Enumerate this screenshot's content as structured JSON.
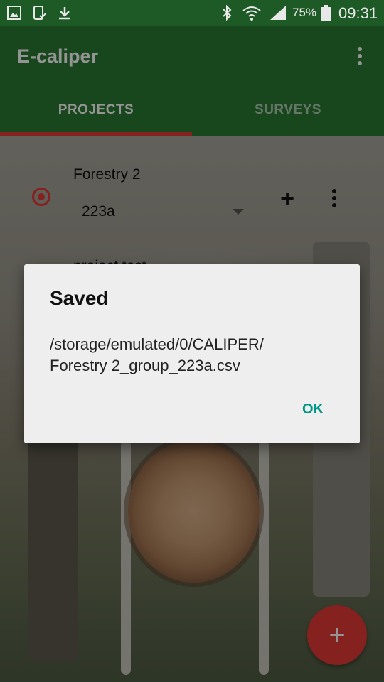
{
  "status_bar": {
    "battery_percent": "75%",
    "time": "09:31",
    "icons": [
      "image-icon",
      "phone-check-icon",
      "download-icon",
      "bluetooth-icon",
      "wifi-icon",
      "signal-icon",
      "battery-icon"
    ]
  },
  "app_bar": {
    "title": "E-caliper",
    "menu_icon": "overflow-menu-icon",
    "tabs": [
      {
        "label": "PROJECTS",
        "selected": true
      },
      {
        "label": "SURVEYS",
        "selected": false
      }
    ]
  },
  "projects": {
    "items": [
      {
        "name": "Forestry 2",
        "selected": true,
        "group": "223a",
        "add_icon": "plus-icon",
        "menu_icon": "more-vert-icon"
      },
      {
        "name": "project test"
      }
    ]
  },
  "fab": {
    "icon": "plus-icon"
  },
  "dialog": {
    "title": "Saved",
    "message_line1": "/storage/emulated/0/CALIPER/",
    "message_line2": "Forestry 2_group_223a.csv",
    "ok_label": "OK"
  },
  "colors": {
    "primary": "#2c7a33",
    "status_bar": "#1e5a26",
    "accent": "#e53935",
    "dialog_button": "#009688"
  }
}
